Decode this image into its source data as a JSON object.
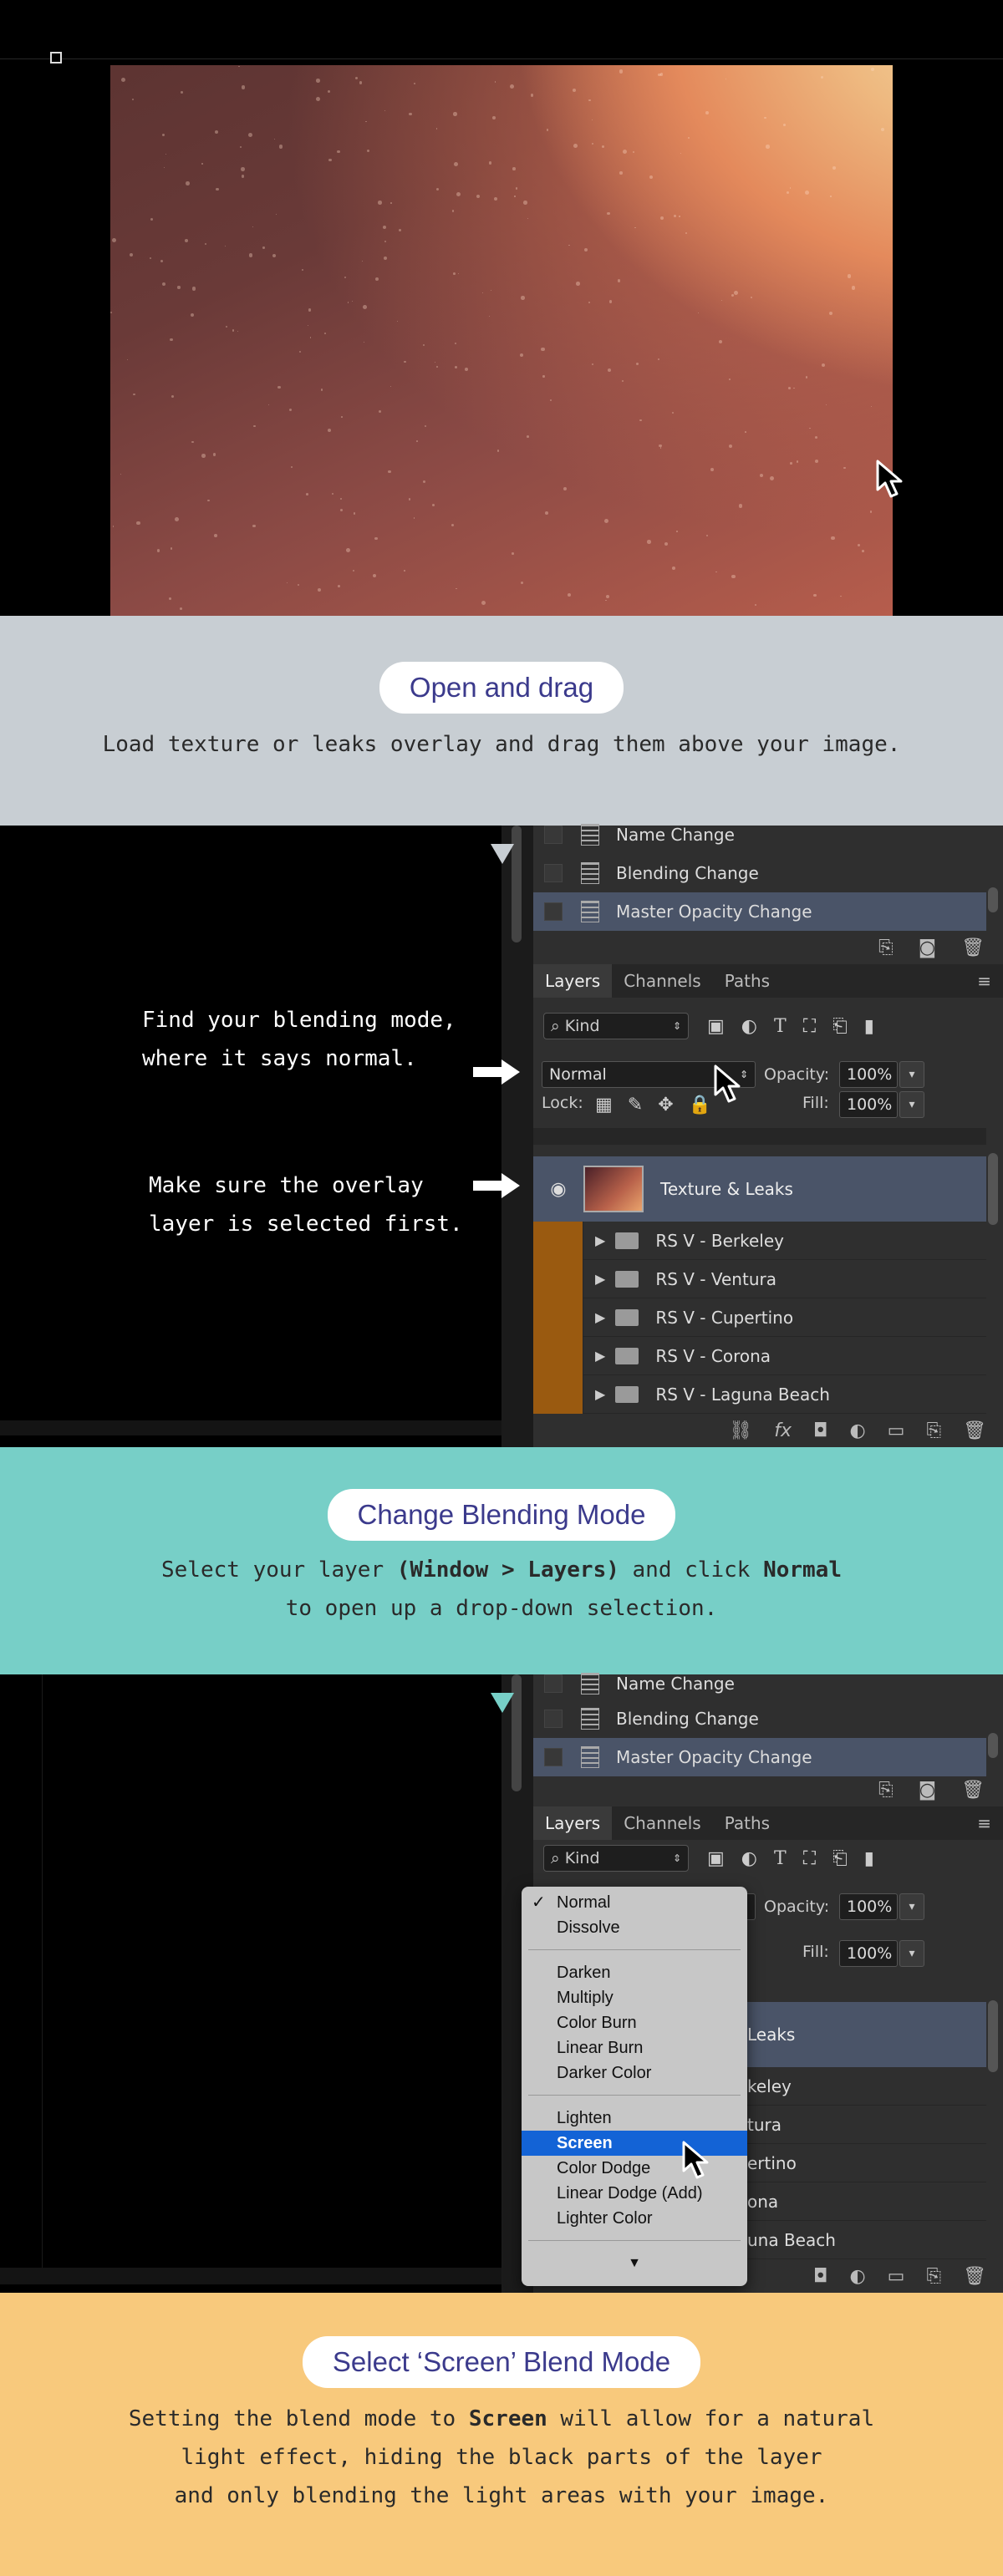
{
  "step1": {
    "title": "Open and drag",
    "description": "Load texture or leaks overlay and drag them above your image."
  },
  "step2": {
    "title": "Change Blending Mode",
    "line1_pre": "Select your layer ",
    "line1_bold": "(Window > Layers)",
    "line1_mid": " and click ",
    "line1_bold2": "Normal",
    "line2": "to open up a drop-down selection."
  },
  "step3": {
    "title": "Select ‘Screen’ Blend Mode",
    "line1_pre": "Setting the blend mode to ",
    "line1_bold": "Screen",
    "line1_post": " will allow for a natural",
    "line2": "light effect, hiding the black parts of the layer",
    "line3": "and only blending the light areas with your image."
  },
  "hints": {
    "blend_line1": "Find your blending mode,",
    "blend_line2": "where it says normal.",
    "select_line1": "Make sure the overlay",
    "select_line2": "layer is selected first."
  },
  "history": {
    "items": [
      "Name Change",
      "Blending Change",
      "Master Opacity Change"
    ]
  },
  "panel": {
    "tabs": [
      "Layers",
      "Channels",
      "Paths"
    ],
    "kind_label": "Kind",
    "blend_mode": "Normal",
    "opacity_label": "Opacity:",
    "opacity_value": "100%",
    "lock_label": "Lock:",
    "fill_label": "Fill:",
    "fill_value": "100%"
  },
  "layers": {
    "selected": "Texture & Leaks",
    "groups": [
      "RS V - Berkeley",
      "RS V - Ventura",
      "RS V - Cupertino",
      "RS V - Corona",
      "RS V - Laguna Beach"
    ],
    "partial": [
      "Leaks",
      "keley",
      "tura",
      "ertino",
      "ona",
      "una Beach"
    ]
  },
  "blend_menu": {
    "group1": [
      "Normal",
      "Dissolve"
    ],
    "group2": [
      "Darken",
      "Multiply",
      "Color Burn",
      "Linear Burn",
      "Darker Color"
    ],
    "group3": [
      "Lighten",
      "Screen",
      "Color Dodge",
      "Linear Dodge (Add)",
      "Lighter Color"
    ],
    "checked": "Normal",
    "highlighted": "Screen",
    "more": "▼"
  },
  "colors": {
    "band1": "#c8ced3",
    "band2": "#77cfc7",
    "band3": "#f8c97c",
    "pill_text": "#3b3a8c",
    "menu_highlight": "#1363d6"
  }
}
